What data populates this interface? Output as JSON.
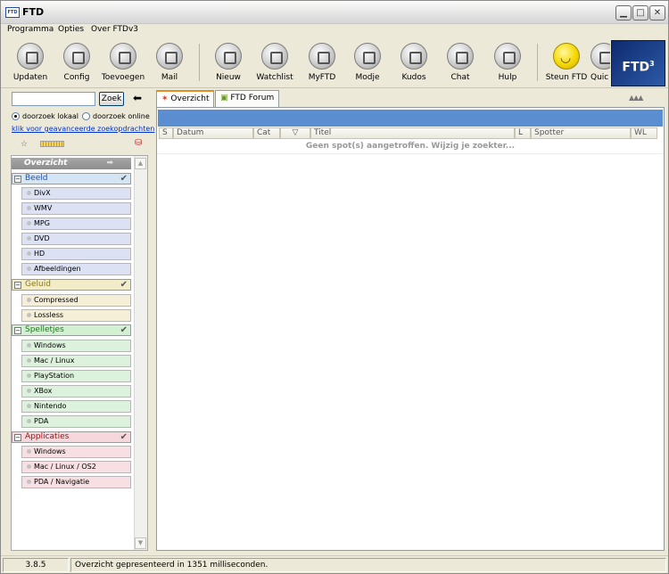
{
  "window": {
    "title": "FTD",
    "app_icon": "FTD"
  },
  "menu": [
    "Programma",
    "Opties",
    "Over FTDv3"
  ],
  "toolbar": {
    "buttons": [
      {
        "label": "Updaten",
        "icon": "update-icon"
      },
      {
        "label": "Config",
        "icon": "config-icon"
      },
      {
        "label": "Toevoegen",
        "icon": "add-icon"
      },
      {
        "label": "Mail",
        "icon": "mail-icon"
      },
      {
        "label": "Nieuw",
        "icon": "new-icon"
      },
      {
        "label": "Watchlist",
        "icon": "watchlist-icon"
      },
      {
        "label": "MyFTD",
        "icon": "myftd-icon"
      },
      {
        "label": "Modje",
        "icon": "modje-icon"
      },
      {
        "label": "Kudos",
        "icon": "kudos-icon"
      },
      {
        "label": "Chat",
        "icon": "chat-icon"
      },
      {
        "label": "Hulp",
        "icon": "help-icon"
      },
      {
        "label": "Steun FTD",
        "icon": "smiley-icon"
      },
      {
        "label": "Quic",
        "icon": "quick-icon"
      }
    ],
    "logo_text": "FTD",
    "logo_sup": "3"
  },
  "search": {
    "value": "",
    "button": "Zoek"
  },
  "scope": {
    "local": "doorzoek lokaal",
    "online": "doorzoek online",
    "selected": "local"
  },
  "advanced_link": "klik voor geavanceerde zoekopdrachten",
  "categories": {
    "overview": "Overzicht",
    "groups": [
      {
        "name": "Beeld",
        "color": "#2450a8",
        "items": [
          "DivX",
          "WMV",
          "MPG",
          "DVD",
          "HD",
          "Afbeeldingen"
        ]
      },
      {
        "name": "Geluid",
        "color": "#8a7a10",
        "items": [
          "Compressed",
          "Lossless"
        ]
      },
      {
        "name": "Spelletjes",
        "color": "#1a7a1a",
        "items": [
          "Windows",
          "Mac / Linux",
          "PlayStation",
          "XBox",
          "Nintendo",
          "PDA"
        ]
      },
      {
        "name": "Applicaties",
        "color": "#a01010",
        "items": [
          "Windows",
          "Mac / Linux / OS2",
          "PDA / Navigatie"
        ]
      }
    ]
  },
  "tabs": [
    {
      "label": "Overzicht",
      "active": true
    },
    {
      "label": "FTD Forum",
      "active": false
    }
  ],
  "table": {
    "columns": [
      "S",
      "Datum",
      "Cat",
      "▽",
      "Titel",
      "L",
      "Spotter",
      "WL"
    ],
    "empty_message": "Geen spot(s) aangetroffen. Wijzig je zoekter..."
  },
  "status": {
    "version": "3.8.5",
    "message": "Overzicht gepresenteerd in 1351 milliseconden."
  }
}
